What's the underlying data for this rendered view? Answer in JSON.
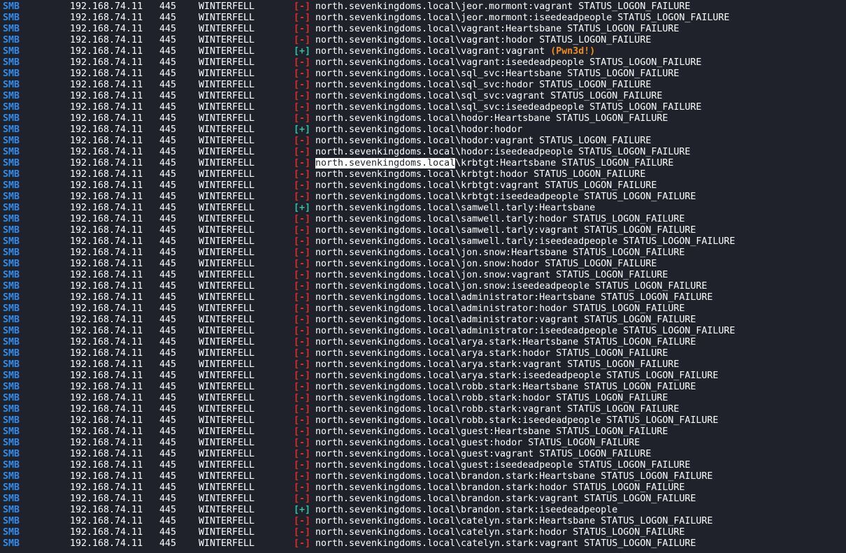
{
  "terminal": {
    "rows": [
      {
        "proto": "SMB",
        "host": "192.168.74.11",
        "port": "445",
        "name": "WINTERFELL",
        "status": "[-]",
        "ok": false,
        "message": "north.sevenkingdoms.local\\jeor.mormont:vagrant STATUS_LOGON_FAILURE"
      },
      {
        "proto": "SMB",
        "host": "192.168.74.11",
        "port": "445",
        "name": "WINTERFELL",
        "status": "[-]",
        "ok": false,
        "message": "north.sevenkingdoms.local\\jeor.mormont:iseedeadpeople STATUS_LOGON_FAILURE"
      },
      {
        "proto": "SMB",
        "host": "192.168.74.11",
        "port": "445",
        "name": "WINTERFELL",
        "status": "[-]",
        "ok": false,
        "message": "north.sevenkingdoms.local\\vagrant:Heartsbane STATUS_LOGON_FAILURE"
      },
      {
        "proto": "SMB",
        "host": "192.168.74.11",
        "port": "445",
        "name": "WINTERFELL",
        "status": "[-]",
        "ok": false,
        "message": "north.sevenkingdoms.local\\vagrant:hodor STATUS_LOGON_FAILURE"
      },
      {
        "proto": "SMB",
        "host": "192.168.74.11",
        "port": "445",
        "name": "WINTERFELL",
        "status": "[+]",
        "ok": true,
        "message": "north.sevenkingdoms.local\\vagrant:vagrant ",
        "pwn": "(Pwn3d!)"
      },
      {
        "proto": "SMB",
        "host": "192.168.74.11",
        "port": "445",
        "name": "WINTERFELL",
        "status": "[-]",
        "ok": false,
        "message": "north.sevenkingdoms.local\\vagrant:iseedeadpeople STATUS_LOGON_FAILURE"
      },
      {
        "proto": "SMB",
        "host": "192.168.74.11",
        "port": "445",
        "name": "WINTERFELL",
        "status": "[-]",
        "ok": false,
        "message": "north.sevenkingdoms.local\\sql_svc:Heartsbane STATUS_LOGON_FAILURE"
      },
      {
        "proto": "SMB",
        "host": "192.168.74.11",
        "port": "445",
        "name": "WINTERFELL",
        "status": "[-]",
        "ok": false,
        "message": "north.sevenkingdoms.local\\sql_svc:hodor STATUS_LOGON_FAILURE"
      },
      {
        "proto": "SMB",
        "host": "192.168.74.11",
        "port": "445",
        "name": "WINTERFELL",
        "status": "[-]",
        "ok": false,
        "message": "north.sevenkingdoms.local\\sql_svc:vagrant STATUS_LOGON_FAILURE"
      },
      {
        "proto": "SMB",
        "host": "192.168.74.11",
        "port": "445",
        "name": "WINTERFELL",
        "status": "[-]",
        "ok": false,
        "message": "north.sevenkingdoms.local\\sql_svc:iseedeadpeople STATUS_LOGON_FAILURE"
      },
      {
        "proto": "SMB",
        "host": "192.168.74.11",
        "port": "445",
        "name": "WINTERFELL",
        "status": "[-]",
        "ok": false,
        "message": "north.sevenkingdoms.local\\hodor:Heartsbane STATUS_LOGON_FAILURE"
      },
      {
        "proto": "SMB",
        "host": "192.168.74.11",
        "port": "445",
        "name": "WINTERFELL",
        "status": "[+]",
        "ok": true,
        "message": "north.sevenkingdoms.local\\hodor:hodor"
      },
      {
        "proto": "SMB",
        "host": "192.168.74.11",
        "port": "445",
        "name": "WINTERFELL",
        "status": "[-]",
        "ok": false,
        "message": "north.sevenkingdoms.local\\hodor:vagrant STATUS_LOGON_FAILURE"
      },
      {
        "proto": "SMB",
        "host": "192.168.74.11",
        "port": "445",
        "name": "WINTERFELL",
        "status": "[-]",
        "ok": false,
        "message": "north.sevenkingdoms.local\\hodor:iseedeadpeople STATUS_LOGON_FAILURE"
      },
      {
        "proto": "SMB",
        "host": "192.168.74.11",
        "port": "445",
        "name": "WINTERFELL",
        "status": "[-]",
        "ok": false,
        "selected": "north.sevenkingdoms.local",
        "message": "\\krbtgt:Heartsbane STATUS_LOGON_FAILURE"
      },
      {
        "proto": "SMB",
        "host": "192.168.74.11",
        "port": "445",
        "name": "WINTERFELL",
        "status": "[-]",
        "ok": false,
        "message": "north.sevenkingdoms.local\\krbtgt:hodor STATUS_LOGON_FAILURE"
      },
      {
        "proto": "SMB",
        "host": "192.168.74.11",
        "port": "445",
        "name": "WINTERFELL",
        "status": "[-]",
        "ok": false,
        "message": "north.sevenkingdoms.local\\krbtgt:vagrant STATUS_LOGON_FAILURE"
      },
      {
        "proto": "SMB",
        "host": "192.168.74.11",
        "port": "445",
        "name": "WINTERFELL",
        "status": "[-]",
        "ok": false,
        "message": "north.sevenkingdoms.local\\krbtgt:iseedeadpeople STATUS_LOGON_FAILURE"
      },
      {
        "proto": "SMB",
        "host": "192.168.74.11",
        "port": "445",
        "name": "WINTERFELL",
        "status": "[+]",
        "ok": true,
        "message": "north.sevenkingdoms.local\\samwell.tarly:Heartsbane"
      },
      {
        "proto": "SMB",
        "host": "192.168.74.11",
        "port": "445",
        "name": "WINTERFELL",
        "status": "[-]",
        "ok": false,
        "message": "north.sevenkingdoms.local\\samwell.tarly:hodor STATUS_LOGON_FAILURE"
      },
      {
        "proto": "SMB",
        "host": "192.168.74.11",
        "port": "445",
        "name": "WINTERFELL",
        "status": "[-]",
        "ok": false,
        "message": "north.sevenkingdoms.local\\samwell.tarly:vagrant STATUS_LOGON_FAILURE"
      },
      {
        "proto": "SMB",
        "host": "192.168.74.11",
        "port": "445",
        "name": "WINTERFELL",
        "status": "[-]",
        "ok": false,
        "message": "north.sevenkingdoms.local\\samwell.tarly:iseedeadpeople STATUS_LOGON_FAILURE"
      },
      {
        "proto": "SMB",
        "host": "192.168.74.11",
        "port": "445",
        "name": "WINTERFELL",
        "status": "[-]",
        "ok": false,
        "message": "north.sevenkingdoms.local\\jon.snow:Heartsbane STATUS_LOGON_FAILURE"
      },
      {
        "proto": "SMB",
        "host": "192.168.74.11",
        "port": "445",
        "name": "WINTERFELL",
        "status": "[-]",
        "ok": false,
        "message": "north.sevenkingdoms.local\\jon.snow:hodor STATUS_LOGON_FAILURE"
      },
      {
        "proto": "SMB",
        "host": "192.168.74.11",
        "port": "445",
        "name": "WINTERFELL",
        "status": "[-]",
        "ok": false,
        "message": "north.sevenkingdoms.local\\jon.snow:vagrant STATUS_LOGON_FAILURE"
      },
      {
        "proto": "SMB",
        "host": "192.168.74.11",
        "port": "445",
        "name": "WINTERFELL",
        "status": "[-]",
        "ok": false,
        "message": "north.sevenkingdoms.local\\jon.snow:iseedeadpeople STATUS_LOGON_FAILURE"
      },
      {
        "proto": "SMB",
        "host": "192.168.74.11",
        "port": "445",
        "name": "WINTERFELL",
        "status": "[-]",
        "ok": false,
        "message": "north.sevenkingdoms.local\\administrator:Heartsbane STATUS_LOGON_FAILURE"
      },
      {
        "proto": "SMB",
        "host": "192.168.74.11",
        "port": "445",
        "name": "WINTERFELL",
        "status": "[-]",
        "ok": false,
        "message": "north.sevenkingdoms.local\\administrator:hodor STATUS_LOGON_FAILURE"
      },
      {
        "proto": "SMB",
        "host": "192.168.74.11",
        "port": "445",
        "name": "WINTERFELL",
        "status": "[-]",
        "ok": false,
        "message": "north.sevenkingdoms.local\\administrator:vagrant STATUS_LOGON_FAILURE"
      },
      {
        "proto": "SMB",
        "host": "192.168.74.11",
        "port": "445",
        "name": "WINTERFELL",
        "status": "[-]",
        "ok": false,
        "message": "north.sevenkingdoms.local\\administrator:iseedeadpeople STATUS_LOGON_FAILURE"
      },
      {
        "proto": "SMB",
        "host": "192.168.74.11",
        "port": "445",
        "name": "WINTERFELL",
        "status": "[-]",
        "ok": false,
        "message": "north.sevenkingdoms.local\\arya.stark:Heartsbane STATUS_LOGON_FAILURE"
      },
      {
        "proto": "SMB",
        "host": "192.168.74.11",
        "port": "445",
        "name": "WINTERFELL",
        "status": "[-]",
        "ok": false,
        "message": "north.sevenkingdoms.local\\arya.stark:hodor STATUS_LOGON_FAILURE"
      },
      {
        "proto": "SMB",
        "host": "192.168.74.11",
        "port": "445",
        "name": "WINTERFELL",
        "status": "[-]",
        "ok": false,
        "message": "north.sevenkingdoms.local\\arya.stark:vagrant STATUS_LOGON_FAILURE"
      },
      {
        "proto": "SMB",
        "host": "192.168.74.11",
        "port": "445",
        "name": "WINTERFELL",
        "status": "[-]",
        "ok": false,
        "message": "north.sevenkingdoms.local\\arya.stark:iseedeadpeople STATUS_LOGON_FAILURE"
      },
      {
        "proto": "SMB",
        "host": "192.168.74.11",
        "port": "445",
        "name": "WINTERFELL",
        "status": "[-]",
        "ok": false,
        "message": "north.sevenkingdoms.local\\robb.stark:Heartsbane STATUS_LOGON_FAILURE"
      },
      {
        "proto": "SMB",
        "host": "192.168.74.11",
        "port": "445",
        "name": "WINTERFELL",
        "status": "[-]",
        "ok": false,
        "message": "north.sevenkingdoms.local\\robb.stark:hodor STATUS_LOGON_FAILURE"
      },
      {
        "proto": "SMB",
        "host": "192.168.74.11",
        "port": "445",
        "name": "WINTERFELL",
        "status": "[-]",
        "ok": false,
        "message": "north.sevenkingdoms.local\\robb.stark:vagrant STATUS_LOGON_FAILURE"
      },
      {
        "proto": "SMB",
        "host": "192.168.74.11",
        "port": "445",
        "name": "WINTERFELL",
        "status": "[-]",
        "ok": false,
        "message": "north.sevenkingdoms.local\\robb.stark:iseedeadpeople STATUS_LOGON_FAILURE"
      },
      {
        "proto": "SMB",
        "host": "192.168.74.11",
        "port": "445",
        "name": "WINTERFELL",
        "status": "[-]",
        "ok": false,
        "message": "north.sevenkingdoms.local\\guest:Heartsbane STATUS_LOGON_FAILURE"
      },
      {
        "proto": "SMB",
        "host": "192.168.74.11",
        "port": "445",
        "name": "WINTERFELL",
        "status": "[-]",
        "ok": false,
        "message": "north.sevenkingdoms.local\\guest:hodor STATUS_LOGON_FAILURE"
      },
      {
        "proto": "SMB",
        "host": "192.168.74.11",
        "port": "445",
        "name": "WINTERFELL",
        "status": "[-]",
        "ok": false,
        "message": "north.sevenkingdoms.local\\guest:vagrant STATUS_LOGON_FAILURE"
      },
      {
        "proto": "SMB",
        "host": "192.168.74.11",
        "port": "445",
        "name": "WINTERFELL",
        "status": "[-]",
        "ok": false,
        "message": "north.sevenkingdoms.local\\guest:iseedeadpeople STATUS_LOGON_FAILURE"
      },
      {
        "proto": "SMB",
        "host": "192.168.74.11",
        "port": "445",
        "name": "WINTERFELL",
        "status": "[-]",
        "ok": false,
        "message": "north.sevenkingdoms.local\\brandon.stark:Heartsbane STATUS_LOGON_FAILURE"
      },
      {
        "proto": "SMB",
        "host": "192.168.74.11",
        "port": "445",
        "name": "WINTERFELL",
        "status": "[-]",
        "ok": false,
        "message": "north.sevenkingdoms.local\\brandon.stark:hodor STATUS_LOGON_FAILURE"
      },
      {
        "proto": "SMB",
        "host": "192.168.74.11",
        "port": "445",
        "name": "WINTERFELL",
        "status": "[-]",
        "ok": false,
        "message": "north.sevenkingdoms.local\\brandon.stark:vagrant STATUS_LOGON_FAILURE"
      },
      {
        "proto": "SMB",
        "host": "192.168.74.11",
        "port": "445",
        "name": "WINTERFELL",
        "status": "[+]",
        "ok": true,
        "message": "north.sevenkingdoms.local\\brandon.stark:iseedeadpeople"
      },
      {
        "proto": "SMB",
        "host": "192.168.74.11",
        "port": "445",
        "name": "WINTERFELL",
        "status": "[-]",
        "ok": false,
        "message": "north.sevenkingdoms.local\\catelyn.stark:Heartsbane STATUS_LOGON_FAILURE"
      },
      {
        "proto": "SMB",
        "host": "192.168.74.11",
        "port": "445",
        "name": "WINTERFELL",
        "status": "[-]",
        "ok": false,
        "message": "north.sevenkingdoms.local\\catelyn.stark:hodor STATUS_LOGON_FAILURE"
      },
      {
        "proto": "SMB",
        "host": "192.168.74.11",
        "port": "445",
        "name": "WINTERFELL",
        "status": "[-]",
        "ok": false,
        "message": "north.sevenkingdoms.local\\catelyn.stark:vagrant STATUS_LOGON_FAILURE"
      }
    ]
  },
  "colors": {
    "background": "#1f212b",
    "protocol": "#2f8df0",
    "failure": "#e02b2b",
    "success": "#2fc1a8",
    "pwned": "#ef8f1c",
    "text": "#ffffff"
  }
}
